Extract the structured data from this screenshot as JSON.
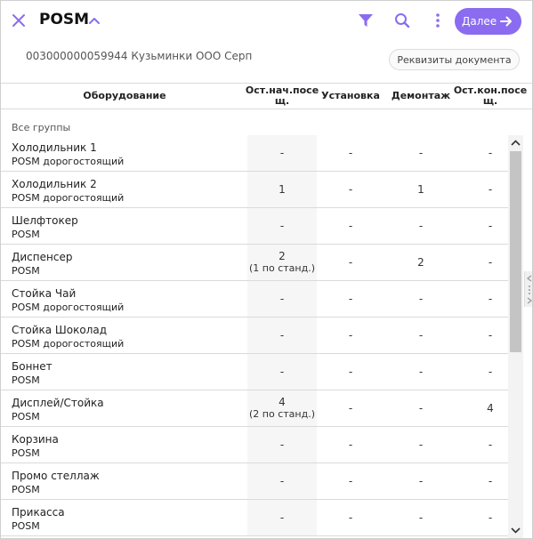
{
  "header": {
    "title": "POSM",
    "next_label": "Далее"
  },
  "document": {
    "line": "003000000059944 Кузьминки ООО Серп",
    "details_button": "Реквизиты документа"
  },
  "table": {
    "columns": [
      "Оборудование",
      "Ост.нач.посе щ.",
      "Установка",
      "Демонтаж",
      "Ост.кон.посе щ."
    ],
    "group_label": "Все группы",
    "rows": [
      {
        "name": "Холодильник 1",
        "type": "POSM дорогостоящий",
        "start": "-",
        "start_note": "",
        "install": "-",
        "dismantle": "-",
        "end": "-"
      },
      {
        "name": "Холодильник 2",
        "type": "POSM дорогостоящий",
        "start": "1",
        "start_note": "",
        "install": "-",
        "dismantle": "1",
        "end": "-"
      },
      {
        "name": "Шелфтокер",
        "type": "POSM",
        "start": "-",
        "start_note": "",
        "install": "-",
        "dismantle": "-",
        "end": "-"
      },
      {
        "name": "Диспенсер",
        "type": "POSM",
        "start": "2",
        "start_note": "(1 по станд.)",
        "install": "-",
        "dismantle": "2",
        "end": "-"
      },
      {
        "name": "Стойка Чай",
        "type": "POSM дорогостоящий",
        "start": "-",
        "start_note": "",
        "install": "-",
        "dismantle": "-",
        "end": "-"
      },
      {
        "name": "Стойка Шоколад",
        "type": "POSM дорогостоящий",
        "start": "-",
        "start_note": "",
        "install": "-",
        "dismantle": "-",
        "end": "-"
      },
      {
        "name": "Боннет",
        "type": "POSM",
        "start": "-",
        "start_note": "",
        "install": "-",
        "dismantle": "-",
        "end": "-"
      },
      {
        "name": "Дисплей/Стойка",
        "type": "POSM",
        "start": "4",
        "start_note": "(2 по станд.)",
        "install": "-",
        "dismantle": "-",
        "end": "4"
      },
      {
        "name": "Корзина",
        "type": "POSM",
        "start": "-",
        "start_note": "",
        "install": "-",
        "dismantle": "-",
        "end": "-"
      },
      {
        "name": "Промо стеллаж",
        "type": "POSM",
        "start": "-",
        "start_note": "",
        "install": "-",
        "dismantle": "-",
        "end": "-"
      },
      {
        "name": "Прикасса",
        "type": "POSM",
        "start": "-",
        "start_note": "",
        "install": "-",
        "dismantle": "-",
        "end": "-"
      }
    ]
  },
  "colors": {
    "accent": "#8b6cf0",
    "text": "#222222",
    "border": "#dadada"
  },
  "icons": {
    "close": "close-icon",
    "collapse": "chevron-up-icon",
    "filter": "filter-icon",
    "search": "search-icon",
    "more": "more-vertical-icon",
    "next": "arrow-right-icon"
  }
}
